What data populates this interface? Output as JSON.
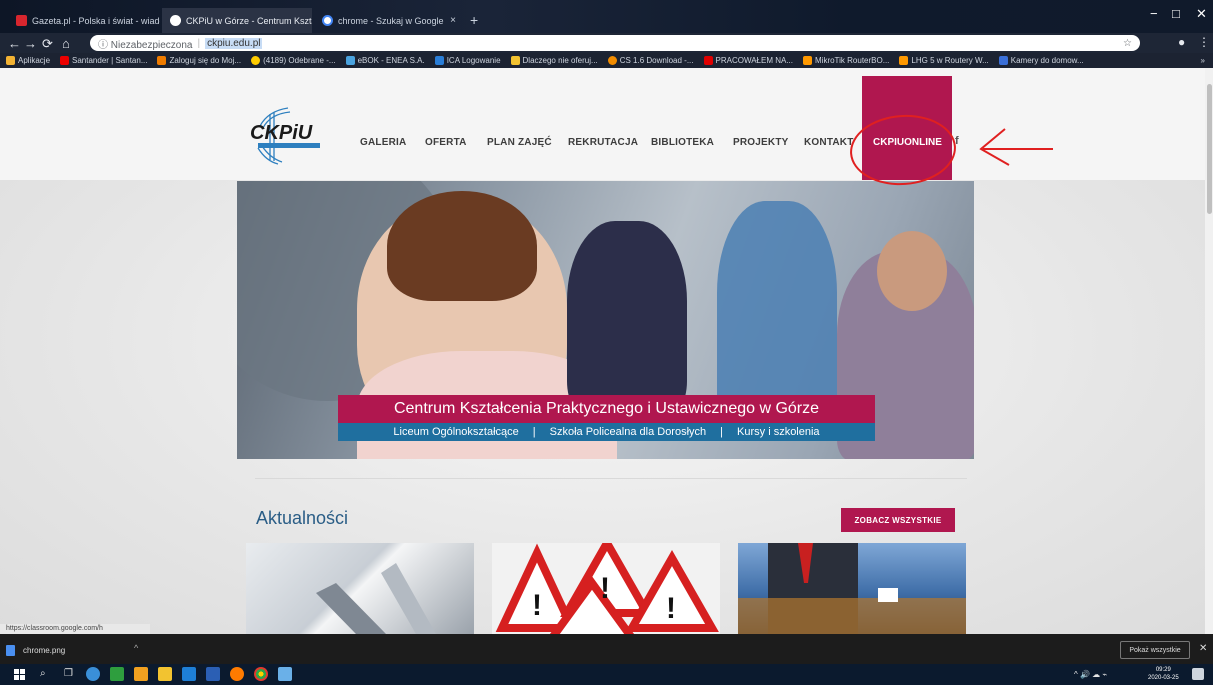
{
  "browser": {
    "tabs": [
      {
        "title": "Gazeta.pl - Polska i świat - wiado",
        "icon": "gazeta-favicon",
        "active": false
      },
      {
        "title": "CKPiU w Górze - Centrum Kształ",
        "icon": "site-favicon",
        "active": true
      },
      {
        "title": "chrome - Szukaj w Google",
        "icon": "google-favicon",
        "active": false
      }
    ],
    "new_tab": "+",
    "window_controls": {
      "minimize": "−",
      "maximize": "□",
      "close": "✕"
    },
    "nav": {
      "back": "←",
      "forward": "→",
      "reload": "⟳",
      "home": "⌂"
    },
    "address": {
      "security_text": "ⓘ Niezabezpieczona",
      "separator": "|",
      "url": "ckpiu.edu.pl",
      "star": "☆"
    },
    "bookmarks": [
      {
        "label": "Aplikacje",
        "color": "#f2b233"
      },
      {
        "label": "Santander | Santan...",
        "color": "#ec0000"
      },
      {
        "label": "Zaloguj się do Moj...",
        "color": "#f07c00"
      },
      {
        "label": "(4189) Odebrane -...",
        "color": "#ffcc00"
      },
      {
        "label": "eBOK - ENEA S.A.",
        "color": "#4aa3df"
      },
      {
        "label": "ICA Logowanie",
        "color": "#2a7ed8"
      },
      {
        "label": "Dlaczego nie oferuj...",
        "color": "#f2c230"
      },
      {
        "label": "CS 1.6 Download -...",
        "color": "#f28c00"
      },
      {
        "label": "PRACOWAŁEM NA...",
        "color": "#e00000"
      },
      {
        "label": "MikroTik RouterBO...",
        "color": "#ff9900"
      },
      {
        "label": "LHG 5 w Routery W...",
        "color": "#ff9900"
      },
      {
        "label": "Kamery do domow...",
        "color": "#3a6fd8"
      }
    ],
    "bookmarks_more": "»",
    "status_link": "https://classroom.google.com/h"
  },
  "site": {
    "logo_text": "CKPiU",
    "menu": [
      "GALERIA",
      "OFERTA",
      "PLAN ZAJĘĆ",
      "REKRUTACJA",
      "BIBLIOTEKA",
      "PROJEKTY",
      "KONTAKT"
    ],
    "highlight_link": "CKPIUONLINE",
    "social_icon": "f",
    "hero": {
      "title": "Centrum Kształcenia Praktycznego i Ustawicznego w Górze",
      "subtitles": [
        "Liceum Ogólnokształcące",
        "|",
        "Szkoła Policealna dla Dorosłych",
        "|",
        "Kursy i szkolenia"
      ]
    },
    "news": {
      "title": "Aktualności",
      "see_all": "ZOBACZ WSZYSTKIE"
    }
  },
  "downloads": {
    "file": "chrome.png",
    "show_all": "Pokaż wszystkie",
    "close": "✕",
    "chevron": "^"
  },
  "taskbar": {
    "time": "09:29",
    "date": "2020-03-25",
    "tray": "^ 🔊 ☁ ⌁"
  },
  "colors": {
    "brand": "#b0174f",
    "hero_sub": "#1f6f9f",
    "annotation": "#e02020",
    "news_title": "#2a5d86"
  }
}
